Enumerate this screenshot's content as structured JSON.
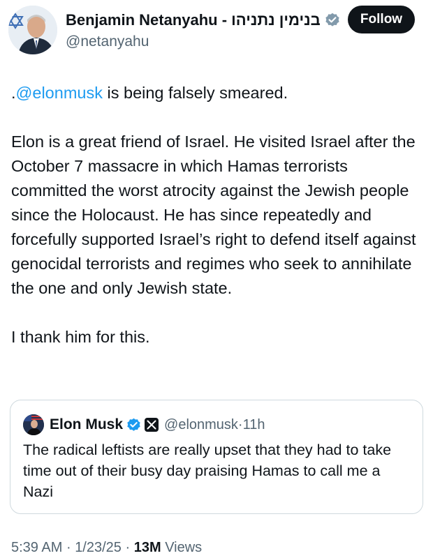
{
  "author": {
    "name": "Benjamin Netanyahu - בנימין נתניהו",
    "handle": "@netanyahu",
    "verified_icon": "verified-badge-icon",
    "verified_color": "#829aab"
  },
  "follow_label": "Follow",
  "tweet": {
    "line1_prefix": ".",
    "line1_mention": "@elonmusk",
    "line1_rest": " is being falsely smeared.",
    "paragraph2": "Elon is a great friend of Israel.  He visited Israel after the October 7 massacre in which Hamas terrorists committed the worst atrocity against the Jewish people since the Holocaust. He has since repeatedly and forcefully supported Israel’s right to defend itself against genocidal terrorists and regimes who seek to annihilate the one and only Jewish state.",
    "paragraph3": "I thank him for this."
  },
  "quote": {
    "name": "Elon Musk",
    "handle": "@elonmusk",
    "separator": "·",
    "time": "11h",
    "text": "The radical leftists are really upset that they had to take time out of their busy day praising Hamas to call me a Nazi",
    "verified_color": "#1d9bf0"
  },
  "meta": {
    "time": "5:39 AM",
    "separator": "·",
    "date": "1/23/25",
    "views_count": "13M",
    "views_label": "Views"
  },
  "colors": {
    "accent": "#1d9bf0",
    "text": "#0f1419",
    "muted": "#536471",
    "border": "#cfd9de"
  }
}
